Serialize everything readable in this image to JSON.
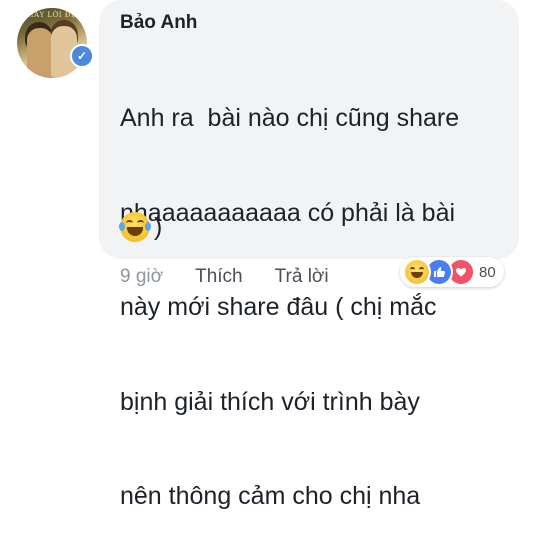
{
  "comment": {
    "author": "Bảo Anh",
    "avatar_text": "THẤY LỜI ĐẸP",
    "verified_icon": "check-icon",
    "lines": [
      "Anh ra  bài nào chị cũng share",
      "nhaaaaaaaaaaa có phải là bài",
      "này mới share đâu ( chị mắc",
      "bịnh giải thích với trình bày",
      "nên thông cảm cho chị nha"
    ],
    "emoji_tail": ")",
    "emoji_icon": "face-with-tears-of-joy-icon"
  },
  "actions": {
    "time": "9 giờ",
    "like_label": "Thích",
    "reply_label": "Trả lời"
  },
  "reactions": {
    "icons": [
      "haha-icon",
      "like-icon",
      "love-icon"
    ],
    "count": "80"
  },
  "colors": {
    "bubble": "#f2f3f5",
    "text": "#1d2129",
    "meta": "#90949c",
    "link": "#4b4f56",
    "like": "#4a7ef0",
    "love": "#f25268",
    "verified": "#4a89dc"
  }
}
